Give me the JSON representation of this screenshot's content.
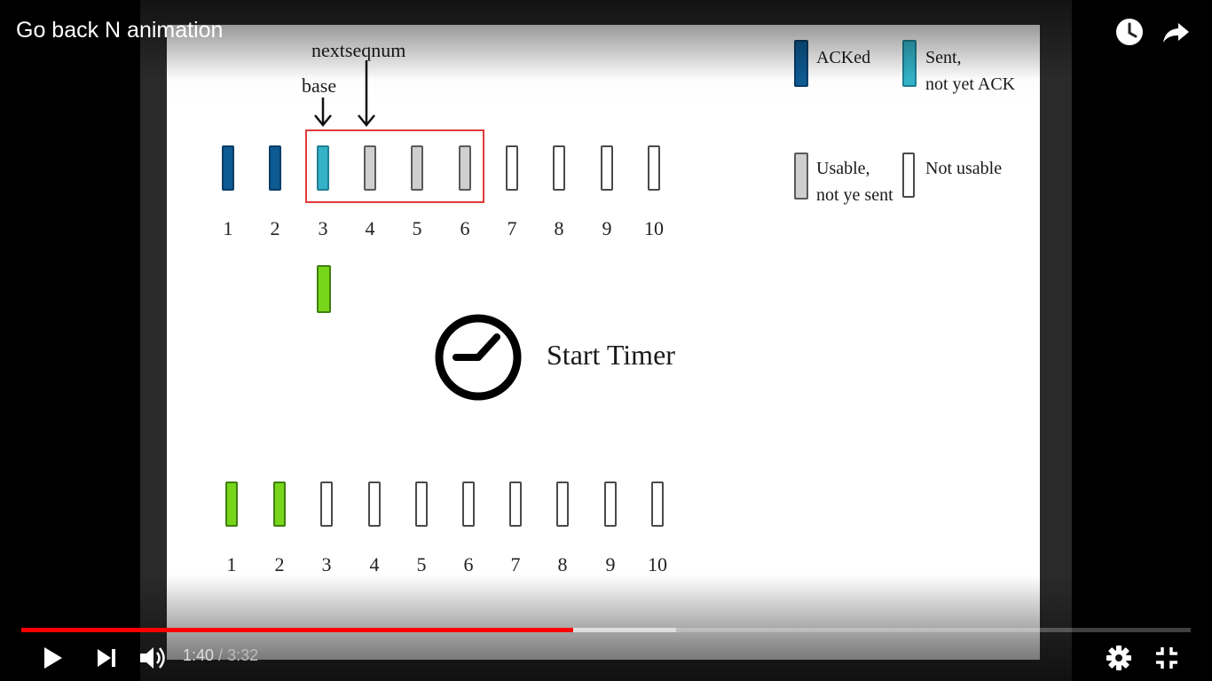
{
  "video": {
    "title": "Go back N animation",
    "current_time": "1:40",
    "duration": "3:32",
    "time_separator": " / ",
    "progress": 0.472,
    "buffered": 0.56
  },
  "controls": {
    "play_icon": "play-icon",
    "next_icon": "next-icon",
    "volume_icon": "volume-icon",
    "settings_icon": "gear-icon",
    "exit_fullscreen_icon": "exit-fullscreen-icon",
    "watch_later_icon": "clock-icon",
    "share_icon": "share-icon"
  },
  "slide": {
    "label_nextseqnum": "nextseqnum",
    "label_base": "base",
    "start_timer": "Start Timer",
    "sender_numbers": [
      "1",
      "2",
      "3",
      "4",
      "5",
      "6",
      "7",
      "8",
      "9",
      "10"
    ],
    "receiver_numbers": [
      "1",
      "2",
      "3",
      "4",
      "5",
      "6",
      "7",
      "8",
      "9",
      "10"
    ],
    "sender_states": [
      "acked",
      "acked",
      "sent",
      "usable",
      "usable",
      "usable",
      "unusable",
      "unusable",
      "unusable",
      "unusable"
    ],
    "receiver_states": [
      "green",
      "green",
      "unusable",
      "unusable",
      "unusable",
      "unusable",
      "unusable",
      "unusable",
      "unusable",
      "unusable"
    ],
    "legend": {
      "acked": "ACKed",
      "sent_l1": "Sent,",
      "sent_l2": "not yet ACK",
      "usable_l1": "Usable,",
      "usable_l2": "not ye sent",
      "not_usable": "Not usable"
    }
  },
  "colors": {
    "acked": "#0e5a92",
    "sent": "#34b2c8",
    "usable": "#cfcfcf",
    "in_transit": "#78d61a",
    "window": "#e23a3a",
    "progress": "#ff0000"
  }
}
